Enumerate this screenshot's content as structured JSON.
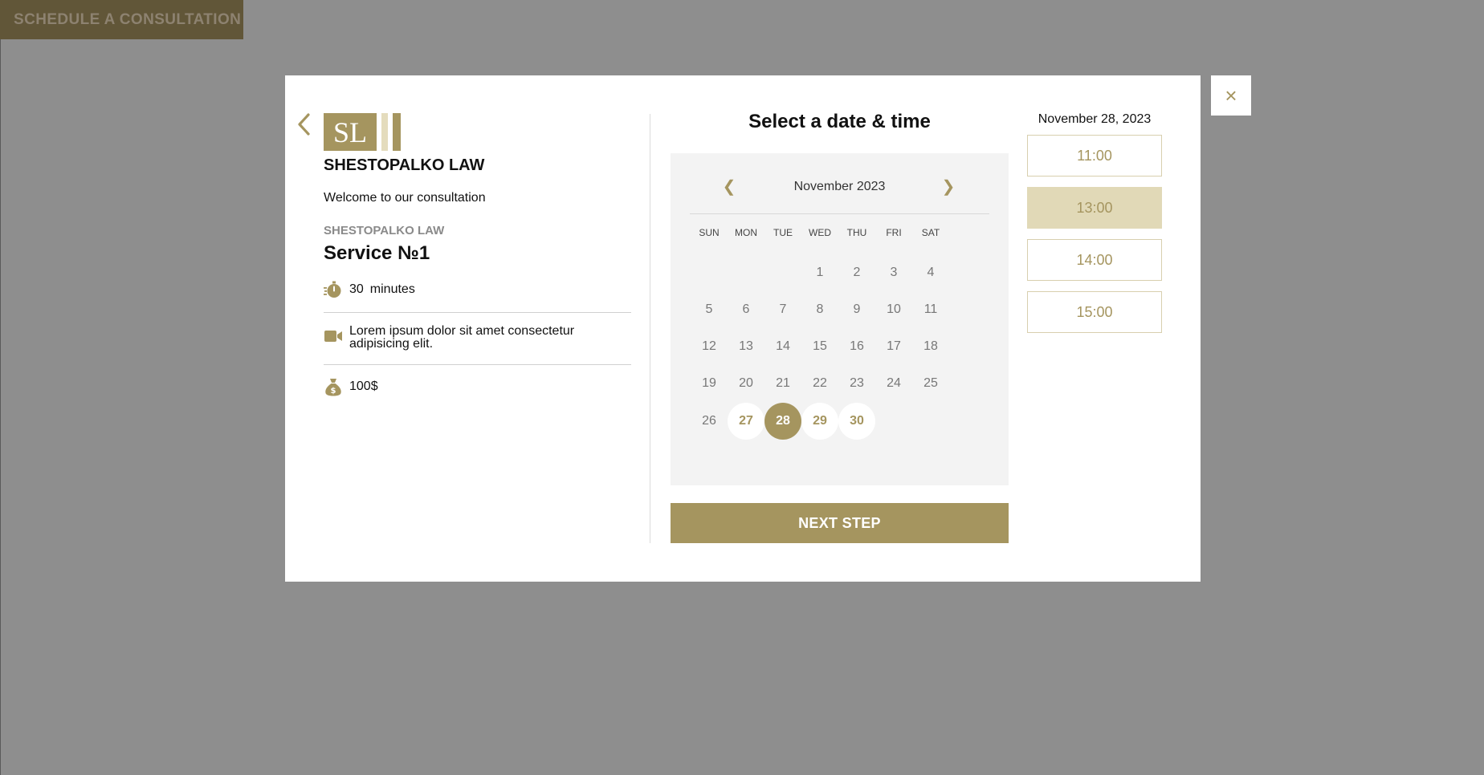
{
  "page": {
    "schedule_button": "SCHEDULE A CONSULTATION",
    "close_label": "×"
  },
  "sidebar": {
    "logo_text": "SL",
    "firm_name": "SHESTOPALKO LAW",
    "welcome": "Welcome to our consultation",
    "firm_sub": "SHESTOPALKO LAW",
    "service_name": "Service №1",
    "duration_value": "30",
    "duration_unit": "minutes",
    "location_text": "Lorem ipsum dolor sit amet consectetur adipisicing elit.",
    "price": "100$",
    "icons": [
      "back-arrow-icon",
      "stopwatch-icon",
      "video-camera-icon",
      "money-bag-icon"
    ]
  },
  "calendar": {
    "heading": "Select a date & time",
    "month_label": "November 2023",
    "prev": "❮",
    "next": "❯",
    "weekdays": [
      "SUN",
      "MON",
      "TUE",
      "WED",
      "THU",
      "FRI",
      "SAT"
    ],
    "weeks": [
      [
        "",
        "",
        "",
        "1",
        "2",
        "3",
        "4"
      ],
      [
        "5",
        "6",
        "7",
        "8",
        "9",
        "10",
        "11"
      ],
      [
        "12",
        "13",
        "14",
        "15",
        "16",
        "17",
        "18"
      ],
      [
        "19",
        "20",
        "21",
        "22",
        "23",
        "24",
        "25"
      ],
      [
        "26",
        "27",
        "28",
        "29",
        "30",
        "",
        ""
      ]
    ],
    "available_days": [
      "27",
      "28",
      "29",
      "30"
    ],
    "selected_day": "28",
    "next_step": "NEXT STEP"
  },
  "times": {
    "selected_date": "November 28, 2023",
    "slots": [
      {
        "label": "11:00",
        "selected": false
      },
      {
        "label": "13:00",
        "selected": true
      },
      {
        "label": "14:00",
        "selected": false
      },
      {
        "label": "15:00",
        "selected": false
      }
    ]
  },
  "colors": {
    "accent": "#a5955f",
    "slot_selected": "#e1d9b7",
    "overlay": "#8e8e8e",
    "calendar_bg": "#f3f3f3"
  }
}
